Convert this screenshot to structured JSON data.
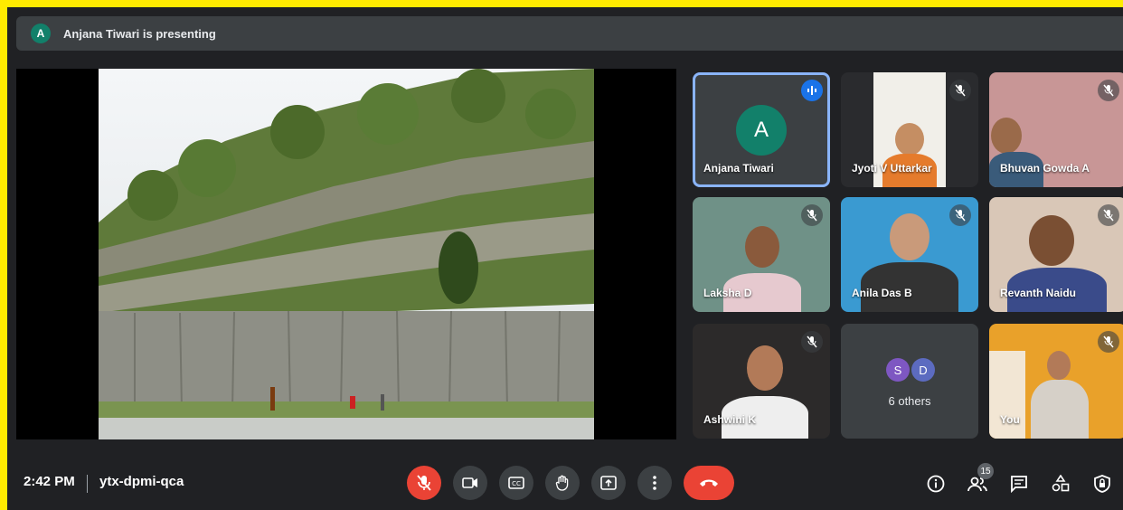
{
  "banner": {
    "avatar_letter": "A",
    "text": "Anjana Tiwari is presenting"
  },
  "meeting": {
    "time": "2:42 PM",
    "code": "ytx-dpmi-qca"
  },
  "participants": [
    {
      "name": "Anjana Tiwari",
      "avatar_letter": "A",
      "speaking": true
    },
    {
      "name": "Jyoti V Uttarkar",
      "muted": true
    },
    {
      "name": "Bhuvan Gowda A",
      "muted": true
    },
    {
      "name": "Laksha D",
      "muted": true
    },
    {
      "name": "Anila Das B",
      "muted": true
    },
    {
      "name": "Revanth Naidu",
      "muted": true
    },
    {
      "name": "Ashwini K",
      "muted": true
    },
    {
      "name": "You",
      "muted": true
    }
  ],
  "others": {
    "letters": [
      "S",
      "D"
    ],
    "label": "6 others"
  },
  "people_count": "15",
  "colors": {
    "background": "#202124",
    "accent": "#8ab4f8",
    "danger": "#ea4335",
    "avatar": "#12806a",
    "border": "#ffeb00"
  },
  "icons": [
    "mic-off-icon",
    "camera-icon",
    "captions-icon",
    "raise-hand-icon",
    "present-icon",
    "more-icon",
    "hangup-icon",
    "info-icon",
    "people-icon",
    "chat-icon",
    "activities-icon",
    "host-controls-icon"
  ]
}
